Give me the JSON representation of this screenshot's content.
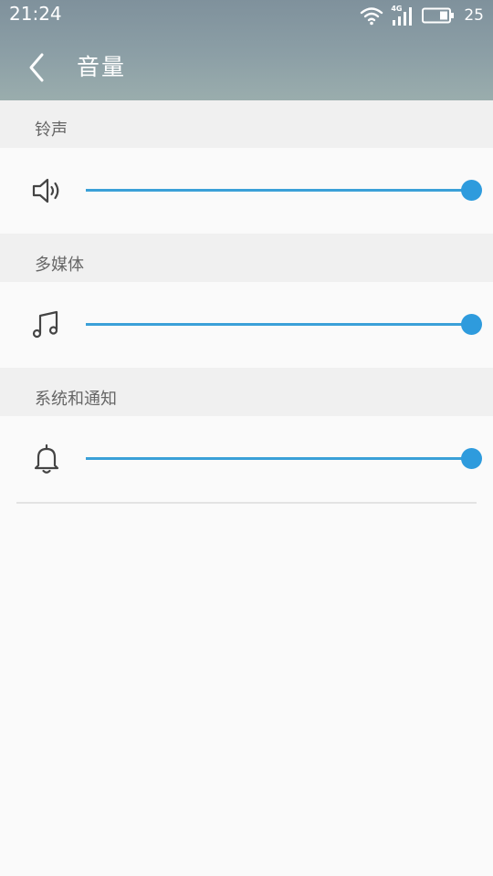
{
  "status_bar": {
    "time": "21:24",
    "network_label": "4G",
    "battery_level": "25",
    "icons": [
      "wifi-icon",
      "cellular-signal-icon",
      "battery-icon"
    ]
  },
  "header": {
    "title": "音量",
    "back_icon": "chevron-left-icon"
  },
  "sections": [
    {
      "label": "铃声",
      "icon": "speaker-icon",
      "volume_percent": 100
    },
    {
      "label": "多媒体",
      "icon": "music-note-icon",
      "volume_percent": 100
    },
    {
      "label": "系统和通知",
      "icon": "bell-icon",
      "volume_percent": 100
    }
  ],
  "colors": {
    "header_gradient_top": "#7f919c",
    "header_gradient_bottom": "#9aadad",
    "accent": "#2e9bdd",
    "section_bg": "#f0f0f0",
    "page_bg": "#fafafa"
  }
}
